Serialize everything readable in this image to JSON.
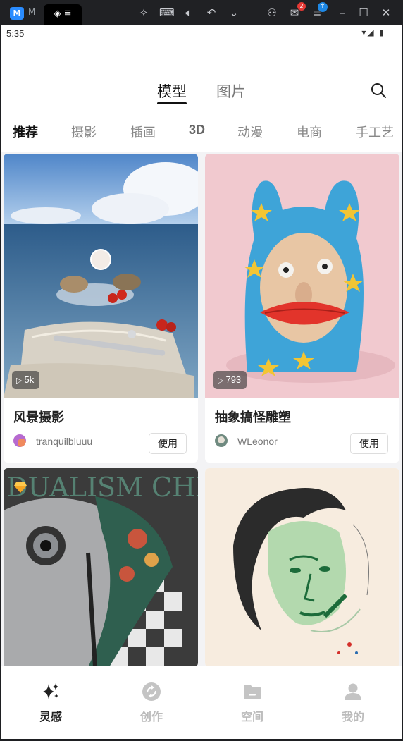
{
  "emulator": {
    "app_letter": "M",
    "tab_label": "◈ ≣",
    "icons": [
      "pin-icon",
      "keyboard-icon",
      "volume-icon",
      "undo-icon",
      "chevron-down-icon",
      "user-icon",
      "mail-icon",
      "menu-icon",
      "minimize-icon",
      "maximize-icon",
      "close-icon"
    ],
    "mail_badge": "2",
    "update_badge": "↑"
  },
  "status": {
    "time": "5:35",
    "sys": "▾◢ ▮"
  },
  "topnav": {
    "tab_model": "模型",
    "tab_image": "图片",
    "search_icon": "search-icon"
  },
  "categories": [
    "推荐",
    "摄影",
    "插画",
    "3D",
    "动漫",
    "电商",
    "手工艺"
  ],
  "cards": [
    {
      "title": "风景摄影",
      "author": "tranquilbluuu",
      "plays": "5k",
      "use": "使用"
    },
    {
      "title": "抽象搞怪雕塑",
      "author": "WLeonor",
      "plays": "793",
      "use": "使用"
    },
    {
      "chess_text": "DUALISM CHESS"
    }
  ],
  "bottomnav": [
    {
      "label": "灵感",
      "icon": "sparkle-icon",
      "active": true
    },
    {
      "label": "创作",
      "icon": "create-icon",
      "active": false
    },
    {
      "label": "空间",
      "icon": "folder-icon",
      "active": false
    },
    {
      "label": "我的",
      "icon": "profile-icon",
      "active": false
    }
  ],
  "colors": {
    "accent": "#111111",
    "inactive": "#bbbbbb",
    "badge": "#e53935"
  }
}
